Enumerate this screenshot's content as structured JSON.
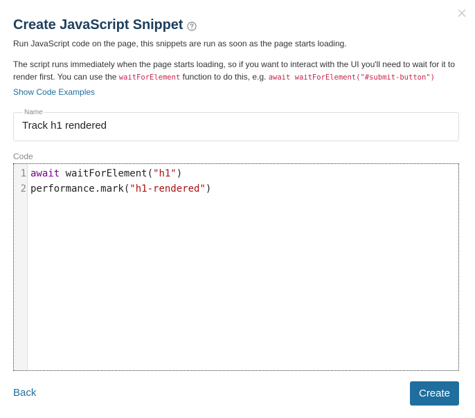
{
  "dialog": {
    "title": "Create JavaScript Snippet",
    "subtitle": "Run JavaScript code on the page, this snippets are run as soon as the page starts loading.",
    "paragraph": {
      "part1": "The script runs immediately when the page starts loading, so if you want to interact with the UI you'll need to wait for it to render first. You can use the ",
      "code1": "waitForElement",
      "part2": " function to do this, e.g. ",
      "code2": "await waitForElement(\"#submit-button\")"
    },
    "examples_link": "Show Code Examples"
  },
  "name_field": {
    "label": "Name",
    "value": "Track h1 rendered"
  },
  "code_field": {
    "label": "Code",
    "lines": [
      {
        "number": "1",
        "keyword": "await",
        "text1": " waitForElement(",
        "string": "\"h1\"",
        "text2": ")"
      },
      {
        "number": "2",
        "keyword": "",
        "text1": "performance.mark(",
        "string": "\"h1-rendered\"",
        "text2": ")"
      }
    ]
  },
  "footer": {
    "back_label": "Back",
    "create_label": "Create"
  },
  "icons": {
    "close": "close-icon",
    "help": "help-circle-icon"
  },
  "colors": {
    "title": "#1d3f5e",
    "link": "#1f6e9e",
    "button": "#1f6e9e",
    "inline_code": "#c7254e",
    "keyword": "#770088",
    "string": "#aa1111"
  }
}
